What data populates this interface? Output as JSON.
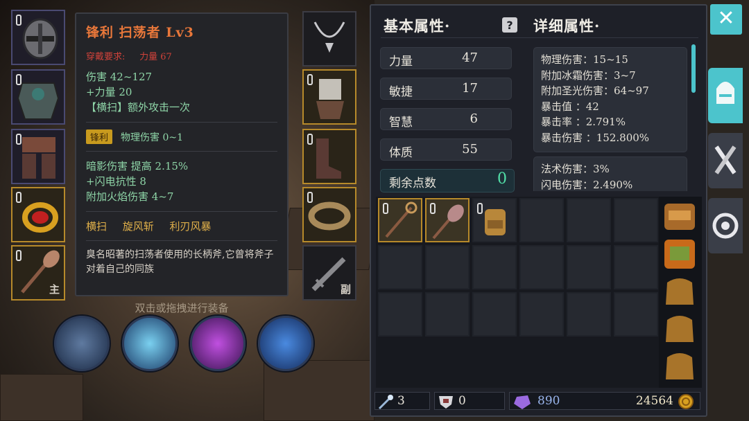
{
  "tooltip": {
    "title": "锋利 扫荡者 Lv3",
    "requirement_label": "穿戴要求:",
    "requirement_value": "力量 67",
    "damage": "伤害  42~127",
    "strength": "+力量 20",
    "sweep": "【横扫】额外攻击一次",
    "affix_badge": "锋利",
    "affix_text": "物理伤害 0~1",
    "stat1": "暗影伤害 提高 2.15%",
    "stat2": "+闪电抗性 8",
    "stat3": "附加火焰伤害 4~7",
    "skills": "横扫  旋风斩  利刃风暴",
    "description": "臭名昭著的扫荡者使用的长柄斧,它曾将斧子对着自己的同族"
  },
  "hint": "双击或拖拽进行装备",
  "equip_left": {
    "mainhand_tag": "主"
  },
  "equip_right": {
    "offhand_tag": "副"
  },
  "basic": {
    "title": "基本属性·",
    "stats": [
      {
        "label": "力量",
        "value": "47"
      },
      {
        "label": "敏捷",
        "value": "17"
      },
      {
        "label": "智慧",
        "value": "6"
      },
      {
        "label": "体质",
        "value": "55"
      }
    ],
    "remaining_label": "剩余点数",
    "remaining_value": "0"
  },
  "detail": {
    "title": "详细属性·",
    "box1": [
      "物理伤害：15~15",
      "附加冰霜伤害：3~7",
      "附加圣光伤害：64~97",
      "暴击值 ：42",
      "暴击率 ：2.791%",
      "暴击伤害 ：152.800%"
    ],
    "box2": [
      "法术伤害：3%",
      "闪电伤害：2.490%"
    ]
  },
  "bottom": {
    "wand_count": "3",
    "shield_count": "0",
    "gems": "890",
    "gold": "24564"
  },
  "close_label": "✕",
  "colors": {
    "accent": "#4cc4cc",
    "gold_border": "#b78a2a",
    "green_text": "#8fd6a8",
    "title_orange": "#e8773a"
  }
}
